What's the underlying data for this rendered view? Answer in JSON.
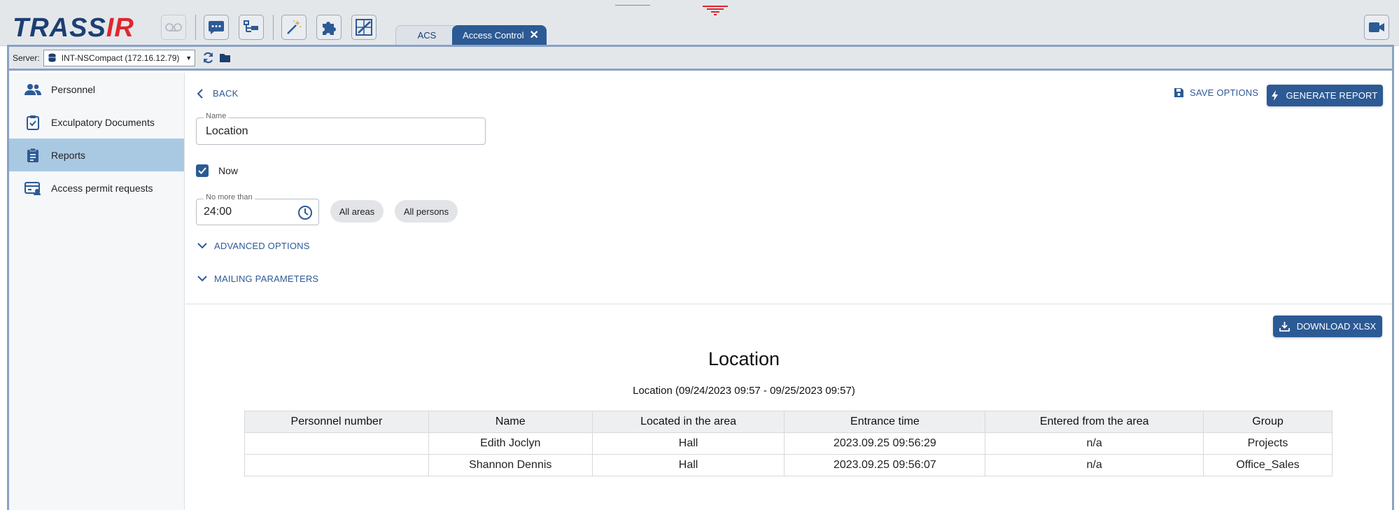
{
  "app": {
    "logo_text": "TRASSIR",
    "tabs": [
      {
        "label": "ACS"
      },
      {
        "label": "Access Control",
        "close": "✕"
      }
    ]
  },
  "toolbar": {
    "icons": [
      "voicemail-icon",
      "chat-icon",
      "schema-icon",
      "magic-wand-icon",
      "puzzle-icon",
      "chart-edit-icon"
    ],
    "camera_icon": "video-camera-icon"
  },
  "server": {
    "label": "Server:",
    "value": "INT-NSCompact (172.16.12.79)"
  },
  "sidebar": {
    "items": [
      {
        "label": "Personnel",
        "icon": "people-icon",
        "active": false
      },
      {
        "label": "Exculpatory Documents",
        "icon": "clipboard-check-icon",
        "active": false
      },
      {
        "label": "Reports",
        "icon": "report-icon",
        "active": true
      },
      {
        "label": "Access permit requests",
        "icon": "id-card-icon",
        "active": false
      }
    ]
  },
  "main": {
    "back_label": "BACK",
    "save_options_label": "SAVE OPTIONS",
    "generate_label": "GENERATE REPORT",
    "name_field": {
      "label": "Name",
      "value": "Location"
    },
    "now_label": "Now",
    "now_checked": true,
    "time_field": {
      "label": "No more than",
      "value": "24:00"
    },
    "chips": [
      "All areas",
      "All persons"
    ],
    "advanced_label": "ADVANCED OPTIONS",
    "mailing_label": "MAILING PARAMETERS",
    "download_label": "DOWNLOAD XLSX"
  },
  "report": {
    "title": "Location",
    "subtitle": "Location (09/24/2023 09:57 - 09/25/2023 09:57)",
    "columns": [
      "Personnel number",
      "Name",
      "Located in the area",
      "Entrance time",
      "Entered from the area",
      "Group"
    ],
    "rows": [
      [
        "",
        "Edith Joclyn",
        "Hall",
        "2023.09.25 09:56:29",
        "n/a",
        "Projects"
      ],
      [
        "",
        "Shannon Dennis",
        "Hall",
        "2023.09.25 09:56:07",
        "n/a",
        "Office_Sales"
      ]
    ]
  },
  "colors": {
    "brand_blue": "#2c5a95",
    "brand_red": "#e1262d",
    "frame": "#8aa2c4",
    "active_sidebar": "#a9c9e3"
  }
}
